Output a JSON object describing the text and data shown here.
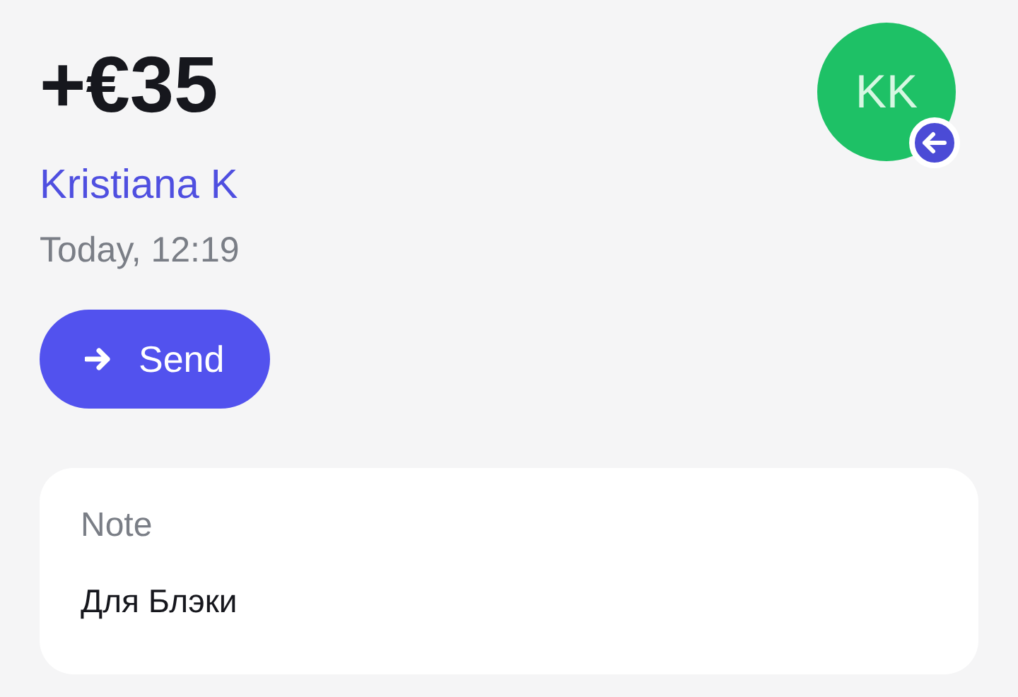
{
  "amount": "+€35",
  "counterparty": {
    "name": "Kristiana K",
    "initials": "KK"
  },
  "time": "Today, 12:19",
  "action_button": {
    "label": "Send"
  },
  "note": {
    "label": "Note",
    "text": "Для Блэки"
  }
}
